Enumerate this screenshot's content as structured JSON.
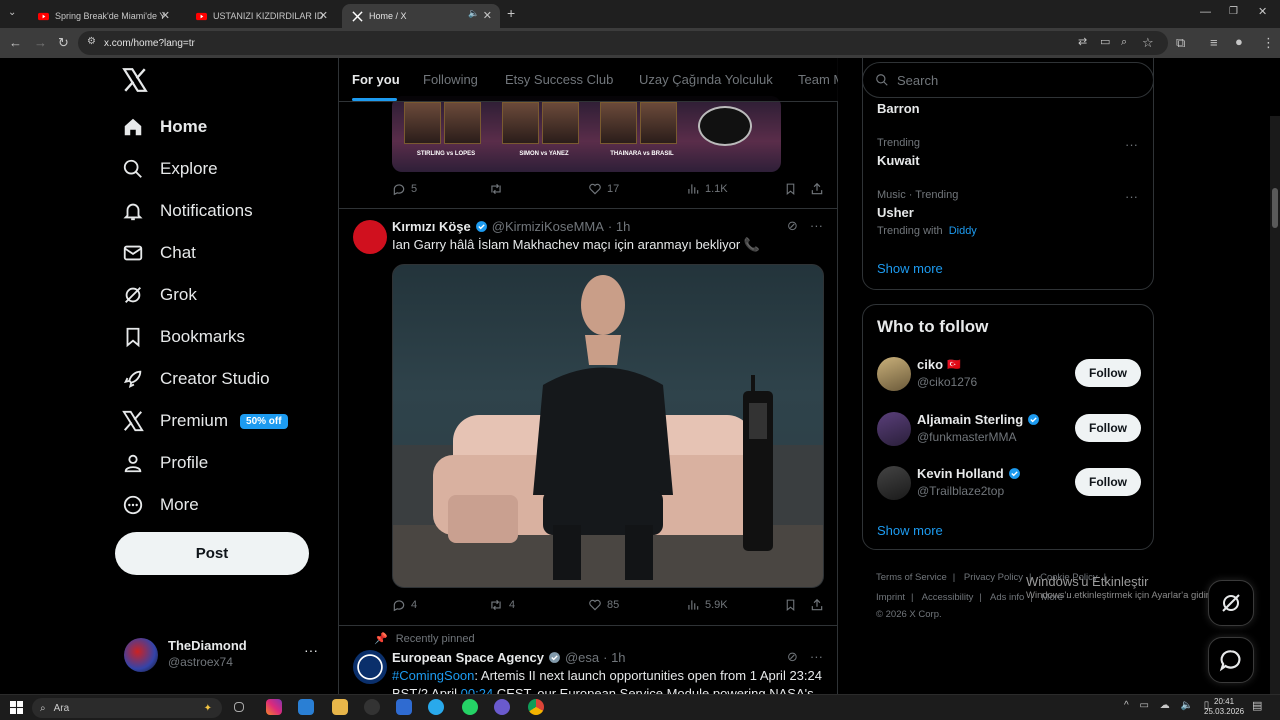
{
  "browser": {
    "tabs": [
      {
        "title": "Spring Break'de Miami'de Yürüy",
        "icon": "youtube-icon"
      },
      {
        "title": "USTANIZI KIZDIRDILAR IDRIS U",
        "icon": "youtube-icon"
      },
      {
        "title": "Home / X",
        "icon": "x-logo-icon"
      }
    ],
    "new_tab": "+",
    "url": "x.com/home?lang=tr"
  },
  "sidebar": {
    "nav": [
      {
        "label": "Home",
        "icon": "home-icon"
      },
      {
        "label": "Explore",
        "icon": "search-icon"
      },
      {
        "label": "Notifications",
        "icon": "bell-icon"
      },
      {
        "label": "Chat",
        "icon": "mail-icon"
      },
      {
        "label": "Grok",
        "icon": "grok-icon"
      },
      {
        "label": "Bookmarks",
        "icon": "bookmark-icon"
      },
      {
        "label": "Creator Studio",
        "icon": "rocket-icon"
      },
      {
        "label": "Premium",
        "icon": "x-logo-icon"
      },
      {
        "label": "Profile",
        "icon": "person-icon"
      },
      {
        "label": "More",
        "icon": "more-circle-icon"
      }
    ],
    "premium_badge": "50% off",
    "post_label": "Post",
    "account": {
      "name": "TheDiamond",
      "handle": "@astroex74"
    }
  },
  "feed": {
    "tabs": [
      "For you",
      "Following",
      "Etsy Success Club",
      "Uzay Çağında Yolculuk",
      "Team M"
    ],
    "card_fights": [
      "STIRLING vs LOPES",
      "SIMON vs YANEZ",
      "THAINARA vs BRASIL"
    ],
    "tweet1_stats": {
      "replies": "5",
      "likes": "17",
      "views": "1.1K"
    },
    "tweet2": {
      "name": "Kırmızı Köşe",
      "handle": "@KirmiziKoseMMA",
      "time": "· 1h",
      "text": "Ian Garry hâlâ İslam Makhachev maçı için aranmayı bekliyor 📞",
      "stats": {
        "replies": "4",
        "reposts": "4",
        "likes": "85",
        "views": "5.9K"
      }
    },
    "pinned_label": "Recently pinned",
    "tweet3": {
      "name": "European Space Agency",
      "handle": "@esa",
      "time": "· 1h",
      "hashtag": "#ComingSoon",
      "text": ": Artemis II next launch opportunities open from 1 April 23:24 BST/2 April ",
      "time_link": "00:24",
      "text2": " CEST, our European Service Module powering NASA's"
    }
  },
  "right": {
    "search_placeholder": "Search",
    "trends": [
      {
        "meta": "",
        "name": "Barron"
      },
      {
        "meta": "Trending",
        "name": "Kuwait"
      },
      {
        "meta": "Music · Trending",
        "name": "Usher",
        "sub_label": "Trending with",
        "sub_link": "Diddy"
      }
    ],
    "show_more": "Show more",
    "who_to_follow": {
      "title": "Who to follow",
      "accounts": [
        {
          "name": "ciko",
          "handle": "@ciko1276",
          "flag": "🇹🇷"
        },
        {
          "name": "Aljamain Sterling",
          "handle": "@funkmasterMMA"
        },
        {
          "name": "Kevin Holland",
          "handle": "@Trailblaze2top"
        }
      ],
      "follow_label": "Follow",
      "show_more": "Show more"
    },
    "footer": [
      "Terms of Service",
      "|",
      "Privacy Policy",
      "|",
      "Cookie Policy",
      "|",
      "Imprint",
      "|",
      "Accessibility",
      "|",
      "Ads info",
      "|",
      "More ···",
      "© 2026 X Corp."
    ]
  },
  "windows": {
    "activate_title": "Windows'u Etkinleştir",
    "activate_sub": "Windows'u etkinleştirmek için Ayarlar'a gidin.",
    "search_label": "Ara",
    "time": "20:41",
    "date": "25.03.2026"
  }
}
